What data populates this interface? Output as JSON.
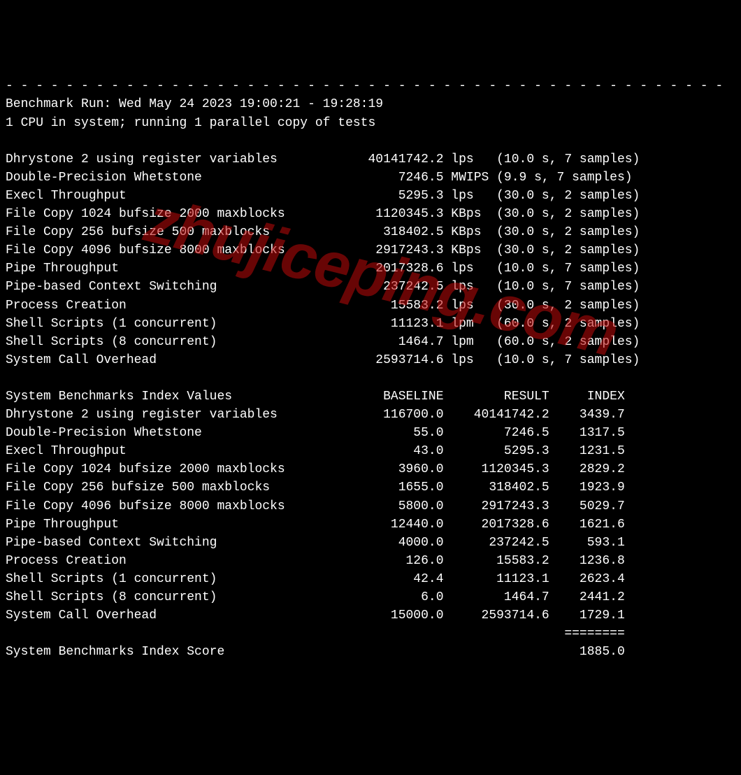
{
  "header": {
    "divider": "- - - - - - - - - - - - - - - - - - - - - - - - - - - - - - - - - - - - - - - - - - - - - - - -",
    "run_line": "Benchmark Run: Wed May 24 2023 19:00:21 - 19:28:19",
    "cpu_line": "1 CPU in system; running 1 parallel copy of tests"
  },
  "tests": [
    {
      "name": "Dhrystone 2 using register variables",
      "value": "40141742.2",
      "unit": "lps",
      "meta": "(10.0 s, 7 samples)"
    },
    {
      "name": "Double-Precision Whetstone",
      "value": "7246.5",
      "unit": "MWIPS",
      "meta": "(9.9 s, 7 samples)"
    },
    {
      "name": "Execl Throughput",
      "value": "5295.3",
      "unit": "lps",
      "meta": "(30.0 s, 2 samples)"
    },
    {
      "name": "File Copy 1024 bufsize 2000 maxblocks",
      "value": "1120345.3",
      "unit": "KBps",
      "meta": "(30.0 s, 2 samples)"
    },
    {
      "name": "File Copy 256 bufsize 500 maxblocks",
      "value": "318402.5",
      "unit": "KBps",
      "meta": "(30.0 s, 2 samples)"
    },
    {
      "name": "File Copy 4096 bufsize 8000 maxblocks",
      "value": "2917243.3",
      "unit": "KBps",
      "meta": "(30.0 s, 2 samples)"
    },
    {
      "name": "Pipe Throughput",
      "value": "2017328.6",
      "unit": "lps",
      "meta": "(10.0 s, 7 samples)"
    },
    {
      "name": "Pipe-based Context Switching",
      "value": "237242.5",
      "unit": "lps",
      "meta": "(10.0 s, 7 samples)"
    },
    {
      "name": "Process Creation",
      "value": "15583.2",
      "unit": "lps",
      "meta": "(30.0 s, 2 samples)"
    },
    {
      "name": "Shell Scripts (1 concurrent)",
      "value": "11123.1",
      "unit": "lpm",
      "meta": "(60.0 s, 2 samples)"
    },
    {
      "name": "Shell Scripts (8 concurrent)",
      "value": "1464.7",
      "unit": "lpm",
      "meta": "(60.0 s, 2 samples)"
    },
    {
      "name": "System Call Overhead",
      "value": "2593714.6",
      "unit": "lps",
      "meta": "(10.0 s, 7 samples)"
    }
  ],
  "index_header": {
    "title": "System Benchmarks Index Values",
    "c1": "BASELINE",
    "c2": "RESULT",
    "c3": "INDEX"
  },
  "index_rows": [
    {
      "name": "Dhrystone 2 using register variables",
      "baseline": "116700.0",
      "result": "40141742.2",
      "index": "3439.7"
    },
    {
      "name": "Double-Precision Whetstone",
      "baseline": "55.0",
      "result": "7246.5",
      "index": "1317.5"
    },
    {
      "name": "Execl Throughput",
      "baseline": "43.0",
      "result": "5295.3",
      "index": "1231.5"
    },
    {
      "name": "File Copy 1024 bufsize 2000 maxblocks",
      "baseline": "3960.0",
      "result": "1120345.3",
      "index": "2829.2"
    },
    {
      "name": "File Copy 256 bufsize 500 maxblocks",
      "baseline": "1655.0",
      "result": "318402.5",
      "index": "1923.9"
    },
    {
      "name": "File Copy 4096 bufsize 8000 maxblocks",
      "baseline": "5800.0",
      "result": "2917243.3",
      "index": "5029.7"
    },
    {
      "name": "Pipe Throughput",
      "baseline": "12440.0",
      "result": "2017328.6",
      "index": "1621.6"
    },
    {
      "name": "Pipe-based Context Switching",
      "baseline": "4000.0",
      "result": "237242.5",
      "index": "593.1"
    },
    {
      "name": "Process Creation",
      "baseline": "126.0",
      "result": "15583.2",
      "index": "1236.8"
    },
    {
      "name": "Shell Scripts (1 concurrent)",
      "baseline": "42.4",
      "result": "11123.1",
      "index": "2623.4"
    },
    {
      "name": "Shell Scripts (8 concurrent)",
      "baseline": "6.0",
      "result": "1464.7",
      "index": "2441.2"
    },
    {
      "name": "System Call Overhead",
      "baseline": "15000.0",
      "result": "2593714.6",
      "index": "1729.1"
    }
  ],
  "score": {
    "divider": "========",
    "label": "System Benchmarks Index Score",
    "value": "1885.0"
  },
  "watermark": "zhujiceping.com"
}
